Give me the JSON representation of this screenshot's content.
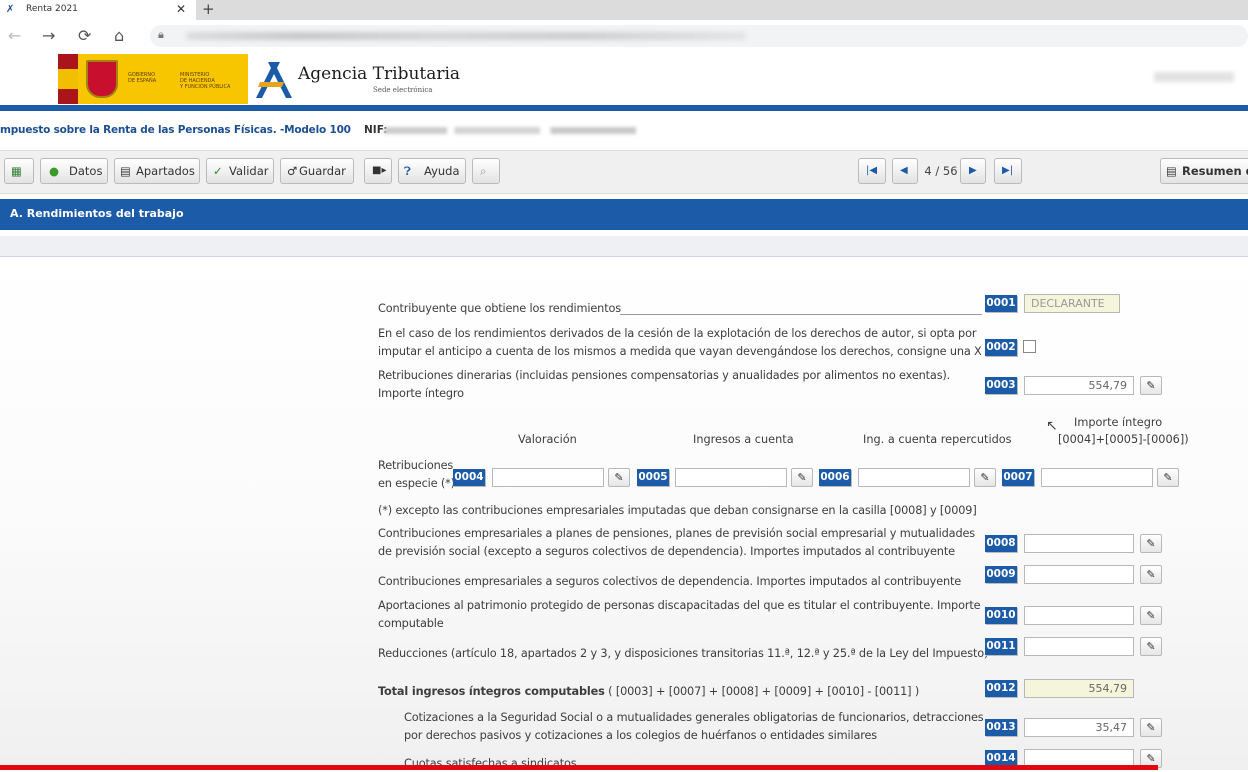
{
  "browser": {
    "tab_title": "Renta 2021",
    "tab_icon": "aeat-favicon",
    "close_glyph": "✕",
    "newtab_glyph": "+"
  },
  "header": {
    "gov_line1": "GOBIERNO",
    "gov_line2": "DE ESPAÑA",
    "ministry_line1": "MINISTERIO",
    "ministry_line2": "DE HACIENDA",
    "ministry_line3": "Y FUNCIÓN PÚBLICA",
    "brand": "Agencia Tributaria",
    "brand_sub": "Sede electrónica"
  },
  "form": {
    "title": "mpuesto sobre la Renta de las Personas Físicas. -Modelo 100",
    "nif_label": "NIF:"
  },
  "toolbar": {
    "datos": "Datos",
    "apartados": "Apartados",
    "validar": "Validar",
    "guardar": "Guardar",
    "ayuda": "Ayuda",
    "page": "4 / 56",
    "resumen": "Resumen de"
  },
  "section": {
    "title": "A.  Rendimientos del trabajo"
  },
  "rows": {
    "r0001": {
      "label": "Contribuyente que obtiene los rendimientos",
      "code": "0001",
      "value": "DECLARANTE"
    },
    "r0002": {
      "label1": "En el caso de los rendimientos derivados de la cesión de la explotación de los derechos de autor, si opta por",
      "label2": "imputar el anticipo a cuenta de los mismos a medida que vayan devengándose los derechos, consigne una X",
      "code": "0002"
    },
    "r0003": {
      "label1": "Retribuciones dinerarias (incluidas pensiones compensatorias y anualidades por alimentos no exentas).",
      "label2": "Importe íntegro",
      "code": "0003",
      "value": "554,79"
    },
    "especie": {
      "col_valoracion": "Valoración",
      "col_ingresos": "Ingresos a cuenta",
      "col_repercutidos": "Ing. a cuenta repercutidos",
      "col_importe1": "Importe íntegro",
      "col_importe2": "[0004]+[0005]-[0006])",
      "label1": "Retribuciones",
      "label2": "en especie (*)",
      "code4": "0004",
      "code5": "0005",
      "code6": "0006",
      "code7": "0007"
    },
    "nota": "(*) excepto las contribuciones empresariales imputadas que deban consignarse en la casilla [0008] y [0009]",
    "r0008": {
      "label1": "Contribuciones empresariales a planes de pensiones, planes de previsión social empresarial y mutualidades",
      "label2": "de previsión social (excepto a seguros colectivos de dependencia). Importes imputados al contribuyente",
      "code": "0008"
    },
    "r0009": {
      "label": "Contribuciones empresariales a seguros colectivos de dependencia. Importes imputados al contribuyente",
      "code": "0009"
    },
    "r0010": {
      "label1": "Aportaciones al patrimonio protegido de personas discapacitadas del que es titular el contribuyente. Importe",
      "label2": "computable",
      "code": "0010"
    },
    "r0011": {
      "label": "Reducciones (artículo 18, apartados 2 y 3, y disposiciones transitorias 11.ª, 12.ª y 25.ª de la Ley del Impuesto)",
      "code": "0011"
    },
    "r0012": {
      "label_bold": "Total ingresos íntegros computables",
      "label_rest": " ( [0003] + [0007] + [0008] + [0009] + [0010] - [0011] )",
      "code": "0012",
      "value": "554,79"
    },
    "r0013": {
      "label1": "Cotizaciones a la Seguridad Social o a mutualidades generales obligatorias de funcionarios, detracciones",
      "label2": "por derechos pasivos y cotizaciones a los colegios de huérfanos o entidades similares",
      "code": "0013",
      "value": "35,47"
    },
    "r0014": {
      "label": "Cuotas satisfechas a sindicatos",
      "code": "0014"
    }
  }
}
